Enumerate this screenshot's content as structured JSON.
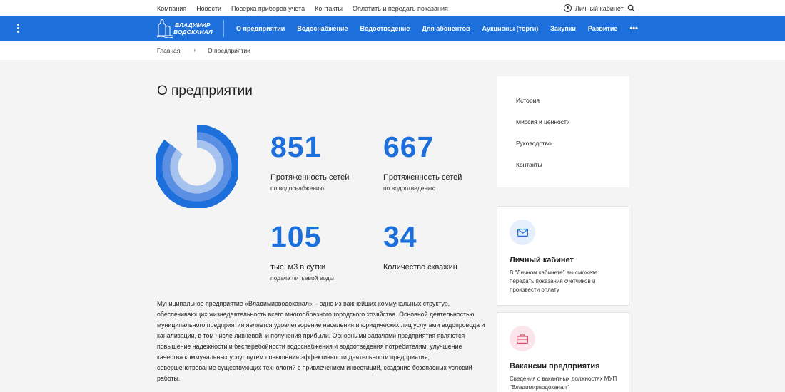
{
  "topbar": {
    "links": [
      "Компания",
      "Новости",
      "Поверка приборов учета",
      "Контакты",
      "Оплатить и передать показания"
    ],
    "account": "Личный кабинет"
  },
  "nav": {
    "logo_text_1": "ВЛАДИМИР",
    "logo_text_2": "ВОДОКАНАЛ",
    "items": [
      "О предприятии",
      "Водоснабжение",
      "Водоотведение",
      "Для абонентов",
      "Аукционы (торги)",
      "Закупки",
      "Развитие"
    ],
    "more": "•••"
  },
  "breadcrumb": {
    "home": "Главная",
    "sep": "›",
    "current": "О предприятии"
  },
  "page_title": "О предприятии",
  "stats": [
    {
      "value": "851",
      "label": "Протяженность сетей",
      "sub": "по водоснабжению"
    },
    {
      "value": "667",
      "label": "Протяженность сетей",
      "sub": "по водоотведению"
    },
    {
      "value": "105",
      "label": "тыс. м3 в сутки",
      "sub": "подача питьевой воды"
    },
    {
      "value": "34",
      "label": "Количество скважин",
      "sub": ""
    }
  ],
  "about_text": "Муниципальное предприятие «Владимирводоканал» – одно из важнейших коммунальных структур, обеспечивающих жизнедеятельность всего многообразного городского хозяйства. Основной деятельностью муниципального предприятия является удовлетворение населения и юридических лиц услугами водопровода и канализации, в том числе ливневой, и получения прибыли. Основными задачами предприятия являются повышение надежности и бесперебойности водоснабжения и водоотведения потребителям, улучшение качества коммунальных услуг путем повышения эффективности деятельности предприятия, совершенствование существующих технологий с привлечением инвестиций, создание безопасных условий работы.",
  "side_menu": [
    "История",
    "Миссия и ценности",
    "Руководство",
    "Контакты"
  ],
  "cards": [
    {
      "icon": "envelope-icon",
      "title": "Личный кабинет",
      "desc": "В \"Личном кабинете\" вы сможете передать показания счетчиков и произвести оплату"
    },
    {
      "icon": "briefcase-icon",
      "title": "Вакансии предприятия",
      "desc": "Сведения о вакантных должностях МУП \"Владимирводоканал\""
    }
  ],
  "colors": {
    "brand_blue": "#1d6fdb",
    "background": "#f4f4f4",
    "ring_light": "#8fb2ea",
    "ring_mid": "#5b8fe3"
  }
}
